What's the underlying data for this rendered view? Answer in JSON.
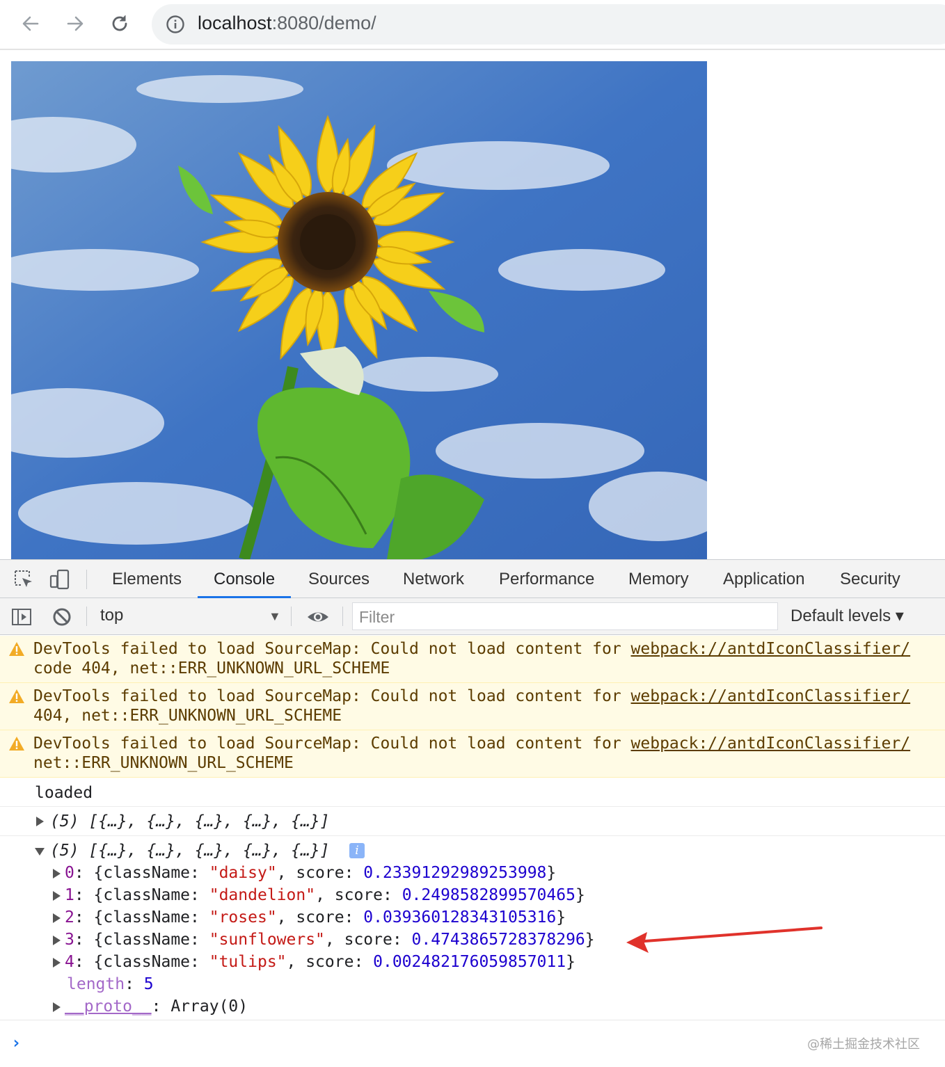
{
  "browser": {
    "url_host": "localhost",
    "url_path": ":8080/demo/",
    "back_icon": "arrow-left-icon",
    "forward_icon": "arrow-right-icon",
    "reload_icon": "reload-icon",
    "info_icon": "info-circle-icon"
  },
  "page": {
    "image_subject": "sunflower-against-blue-sky"
  },
  "devtools": {
    "tabs": [
      "Elements",
      "Console",
      "Sources",
      "Network",
      "Performance",
      "Memory",
      "Application",
      "Security"
    ],
    "active_tab": "Console",
    "toolbar": {
      "context": "top",
      "filter_placeholder": "Filter",
      "levels": "Default levels ▾"
    },
    "accent_color": "#1a73e8"
  },
  "console": {
    "warnings": [
      {
        "text": "DevTools failed to load SourceMap: Could not load content for ",
        "link": "webpack://antdIconClassifier/",
        "line2": "code 404, net::ERR_UNKNOWN_URL_SCHEME"
      },
      {
        "text": "DevTools failed to load SourceMap: Could not load content for ",
        "link": "webpack://antdIconClassifier/",
        "line2": "404, net::ERR_UNKNOWN_URL_SCHEME"
      },
      {
        "text": "DevTools failed to load SourceMap: Could not load content for ",
        "link": "webpack://antdIconClassifier/",
        "line2": "net::ERR_UNKNOWN_URL_SCHEME"
      }
    ],
    "log_loaded": "loaded",
    "collapsed_array": "(5) [{…}, {…}, {…}, {…}, {…}]",
    "expanded_array": "(5) [{…}, {…}, {…}, {…}, {…}]",
    "predictions": [
      {
        "index": "0",
        "className": "\"daisy\"",
        "score": "0.23391292989253998"
      },
      {
        "index": "1",
        "className": "\"dandelion\"",
        "score": "0.2498582899570465"
      },
      {
        "index": "2",
        "className": "\"roses\"",
        "score": "0.039360128343105316"
      },
      {
        "index": "3",
        "className": "\"sunflowers\"",
        "score": "0.4743865728378296"
      },
      {
        "index": "4",
        "className": "\"tulips\"",
        "score": "0.002482176059857011"
      }
    ],
    "length_label": "length",
    "length_value": "5",
    "proto_label": "__proto__",
    "proto_value": "Array(0)",
    "watermark": "@稀土掘金技术社区"
  }
}
